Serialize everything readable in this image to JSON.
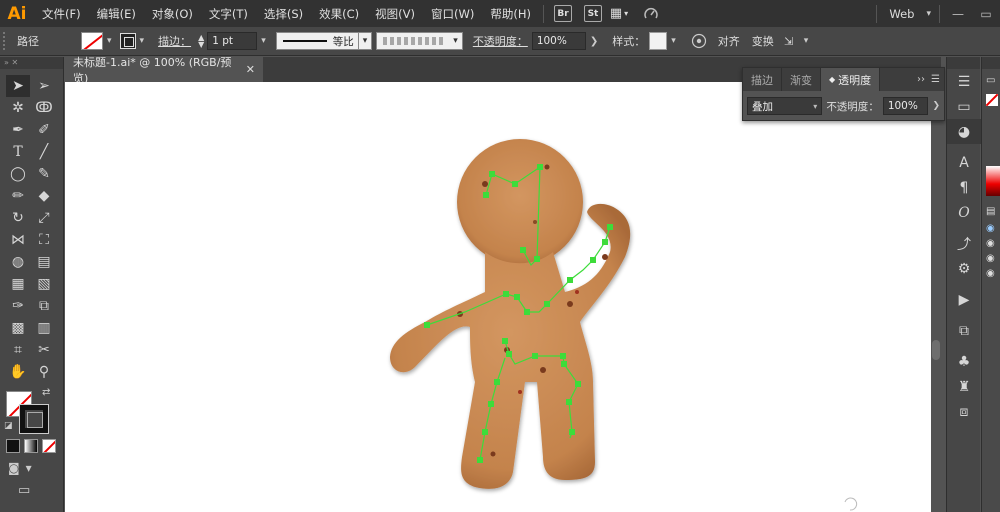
{
  "app": {
    "logo": "Ai"
  },
  "menu": [
    "文件(F)",
    "编辑(E)",
    "对象(O)",
    "文字(T)",
    "选择(S)",
    "效果(C)",
    "视图(V)",
    "窗口(W)",
    "帮助(H)"
  ],
  "menu_extras": {
    "bridge": "Br",
    "stock": "St"
  },
  "workspace": {
    "label": "Web"
  },
  "control": {
    "selection_label": "路径",
    "stroke_label": "描边",
    "stroke_weight": "1 pt",
    "profile_label": "等比",
    "opacity_label": "不透明度",
    "opacity_value": "100%",
    "style_label": "样式",
    "align_label": "对齐",
    "transform_label": "变换"
  },
  "document": {
    "tab_title": "未标题-1.ai* @ 100% (RGB/预览)"
  },
  "transparency_panel": {
    "tabs": [
      "描边",
      "渐变",
      "透明度"
    ],
    "active_tab": "透明度",
    "blend_mode": "叠加",
    "opacity_label": "不透明度",
    "opacity_value": "100%"
  },
  "colors": {
    "accent": "#ff9a00",
    "cookie": "#c98a55",
    "path": "#3ddc3a"
  }
}
